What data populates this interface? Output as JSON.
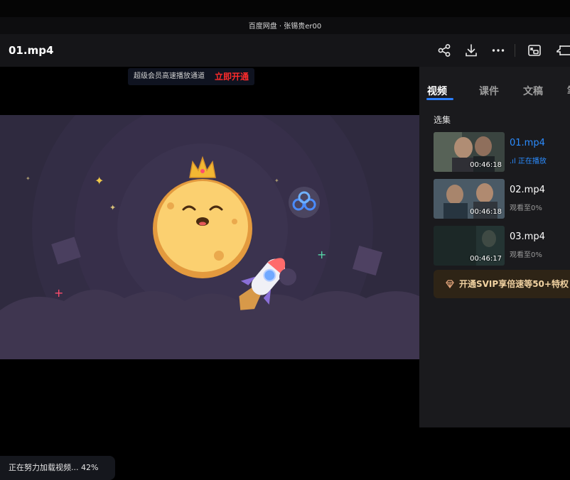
{
  "window": {
    "title": "百度网盘 · 张锡贵er00"
  },
  "header": {
    "filename": "01.mp4"
  },
  "toolbar": {
    "icons": [
      "share-icon",
      "download-icon",
      "more-icon",
      "picture-in-picture-icon",
      "pin-icon"
    ]
  },
  "player": {
    "promo_text": "超级会员高速播放通道",
    "promo_cta": "立即开通",
    "loading_text": "正在努力加载视频... 42%",
    "loading_progress": 0.42
  },
  "sidebar": {
    "tabs": [
      "视频",
      "课件",
      "文稿",
      "笔"
    ],
    "active_tab": "视频",
    "section_title": "选集",
    "episodes": [
      {
        "name": "01.mp4",
        "duration": "00:46:18",
        "status": "正在播放",
        "playing": true
      },
      {
        "name": "02.mp4",
        "duration": "00:46:18",
        "status": "观看至0%",
        "playing": false
      },
      {
        "name": "03.mp4",
        "duration": "00:46:17",
        "status": "观看至0%",
        "playing": false
      }
    ],
    "svip_text": "开通SVIP享倍速等50+特权"
  },
  "colors": {
    "accent": "#2b8cff",
    "promo_cta": "#ff2b2b",
    "svip_text": "#f2d3a2"
  }
}
